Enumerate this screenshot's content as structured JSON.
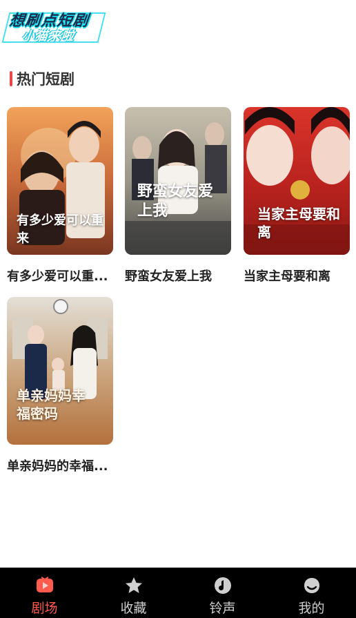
{
  "logo": {
    "line1": "想刷点短剧",
    "line2": "小猫来啦"
  },
  "section": {
    "title": "热门短剧"
  },
  "dramas": [
    {
      "title": "有多少爱可以重...",
      "poster_text": "有多少爱可以重来"
    },
    {
      "title": "野蛮女友爱上我",
      "poster_text": "野蛮女友爱上我"
    },
    {
      "title": "当家主母要和离",
      "poster_text": "当家主母要和离"
    },
    {
      "title": "单亲妈妈的幸福...",
      "poster_text": "单亲妈妈幸福密码"
    }
  ],
  "tabs": [
    {
      "label": "剧场",
      "icon": "tv-icon",
      "active": true
    },
    {
      "label": "收藏",
      "icon": "star-icon",
      "active": false
    },
    {
      "label": "铃声",
      "icon": "music-icon",
      "active": false
    },
    {
      "label": "我的",
      "icon": "profile-icon",
      "active": false
    }
  ],
  "colors": {
    "accent": "#ef4444",
    "tab_active": "#ff5a4e",
    "tabbar_bg": "#000000"
  }
}
